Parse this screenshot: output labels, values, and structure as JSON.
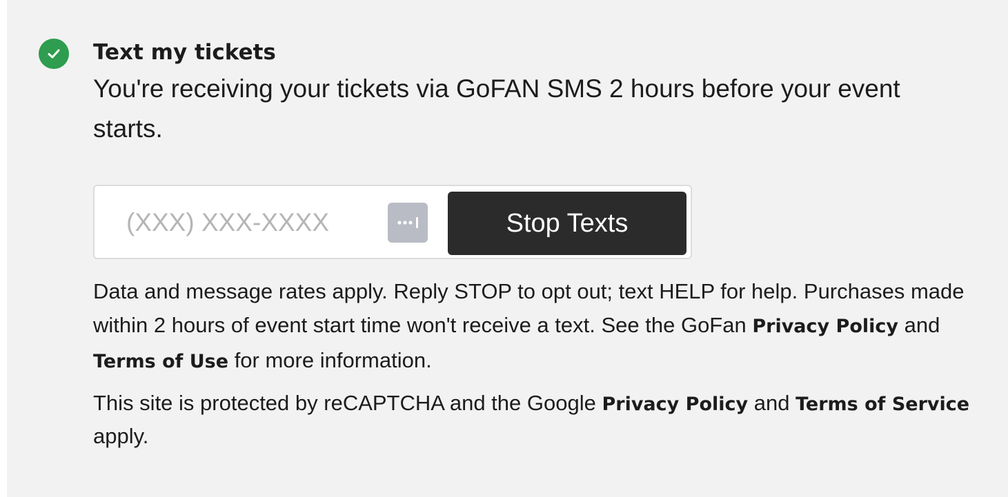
{
  "header": {
    "status_icon": "check-circle-icon",
    "title": "Text my tickets",
    "description": "You're receiving your tickets via GoFAN SMS 2 hours before your event starts."
  },
  "sms_form": {
    "phone_placeholder": "(XXX) XXX-XXXX",
    "phone_value": "",
    "autofill_icon": "password-dots-icon",
    "stop_button_label": "Stop Texts"
  },
  "disclaimer": {
    "text_1": "Data and message rates apply. Reply STOP to opt out; text HELP for help. Purchases made within 2 hours of event start time won't receive a text. See the GoFan ",
    "privacy_link": "Privacy Policy",
    "text_2": " and ",
    "terms_link": "Terms of Use",
    "text_3": " for more information."
  },
  "recaptcha": {
    "text_1": "This site is protected by reCAPTCHA and the Google ",
    "privacy_link": "Privacy Policy",
    "text_2": " and ",
    "terms_link": "Terms of Service",
    "text_3": " apply."
  },
  "colors": {
    "panel_bg": "#f2f2f2",
    "check_green": "#2e9d4f",
    "button_bg": "#2b2b2b",
    "autofill_bg": "#b9bcc4"
  }
}
